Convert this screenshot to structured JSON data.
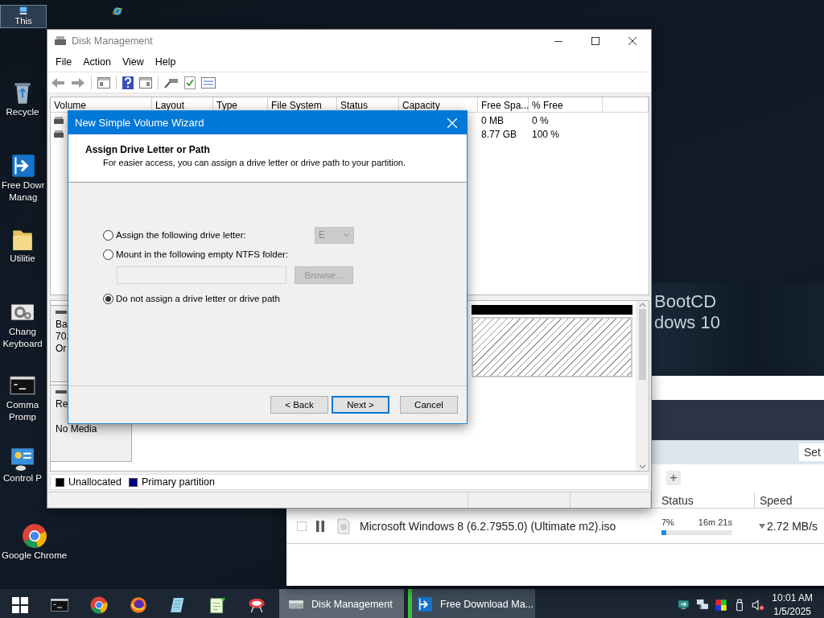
{
  "desktop": {
    "icon_columns": [
      [
        {
          "kind": "pc",
          "label": [
            "This"
          ],
          "selected": true
        },
        {
          "kind": "recycle",
          "label": [
            "Recycle"
          ],
          "selected": false
        },
        {
          "kind": "fdm",
          "label": [
            "Free Dowr",
            "Manag"
          ],
          "selected": false
        },
        {
          "kind": "folder",
          "label": [
            "Utilitie"
          ],
          "selected": false
        },
        {
          "kind": "settings",
          "label": [
            "Chang",
            "Keyboard"
          ],
          "selected": false
        },
        {
          "kind": "terminal",
          "label": [
            "Comma",
            "Promp"
          ],
          "selected": false
        },
        {
          "kind": "control-panel",
          "label": [
            "Control P"
          ],
          "selected": false
        },
        {
          "kind": "chrome",
          "label": [
            "Google Chrome"
          ],
          "selected": false
        }
      ],
      [
        {
          "kind": "ie",
          "selected": false
        }
      ]
    ],
    "wallpaper_text": [
      "BootCD",
      "dows 10"
    ]
  },
  "disk_management": {
    "title": "Disk Management",
    "menu": [
      "File",
      "Action",
      "View",
      "Help"
    ],
    "volume_table": {
      "columns": [
        "Volume",
        "Layout",
        "Type",
        "File System",
        "Status",
        "Capacity",
        "Free Spa...",
        "% Free"
      ],
      "rows": [
        {
          "free_space": "0 MB",
          "percent_free": "0 %"
        },
        {
          "free_space": "8.77 GB",
          "percent_free": "100 %"
        }
      ]
    },
    "disks": [
      {
        "lines": [
          "Ba",
          "70.",
          "Or"
        ]
      },
      {
        "lines": [
          "Re"
        ],
        "note": "No Media"
      }
    ],
    "legend": [
      {
        "label": "Unallocated",
        "color": "#000000"
      },
      {
        "label": "Primary partition",
        "color": "#000080"
      }
    ]
  },
  "wizard": {
    "title": "New Simple Volume Wizard",
    "heading": "Assign Drive Letter or Path",
    "subtitle": "For easier access, you can assign a drive letter or drive path to your partition.",
    "options": [
      {
        "label": "Assign the following drive letter:",
        "selected": false
      },
      {
        "label": "Mount in the following empty NTFS folder:",
        "selected": false
      },
      {
        "label": "Do not assign a drive letter or drive path",
        "selected": true
      }
    ],
    "drive_letter": {
      "value": "E",
      "disabled": true
    },
    "folder_field": {
      "disabled": true
    },
    "browse_button": {
      "label": "Browse...",
      "disabled": true
    },
    "buttons": [
      {
        "label": "< Back",
        "default": false
      },
      {
        "label": "Next >",
        "default": true
      },
      {
        "label": "Cancel",
        "default": false
      }
    ]
  },
  "download_manager": {
    "settings_button": "Set",
    "add_button": "+",
    "columns": [
      "Status",
      "Speed"
    ],
    "downloads": [
      {
        "name": "Microsoft Windows 8 (6.2.7955.0) (Ultimate m2).iso",
        "percent": "7%",
        "remaining": "16m 21s",
        "level": 0.07,
        "speed": "2.72 MB/s",
        "checked": false
      }
    ]
  },
  "taskbar": {
    "pinned": [
      {
        "kind": "terminal"
      },
      {
        "kind": "chrome"
      },
      {
        "kind": "firefox"
      },
      {
        "kind": "notepad"
      },
      {
        "kind": "editor"
      },
      {
        "kind": "tool"
      }
    ],
    "tasks": [
      {
        "kind": "disk",
        "label": "Disk Management",
        "active": true
      },
      {
        "kind": "fdm",
        "label": "Free Download Ma...",
        "active": false
      }
    ],
    "tray": [
      {
        "kind": "sync"
      },
      {
        "kind": "network"
      },
      {
        "kind": "color"
      },
      {
        "kind": "usb"
      },
      {
        "kind": "mute"
      }
    ],
    "time": "10:01 AM",
    "date": "1/5/2025"
  }
}
